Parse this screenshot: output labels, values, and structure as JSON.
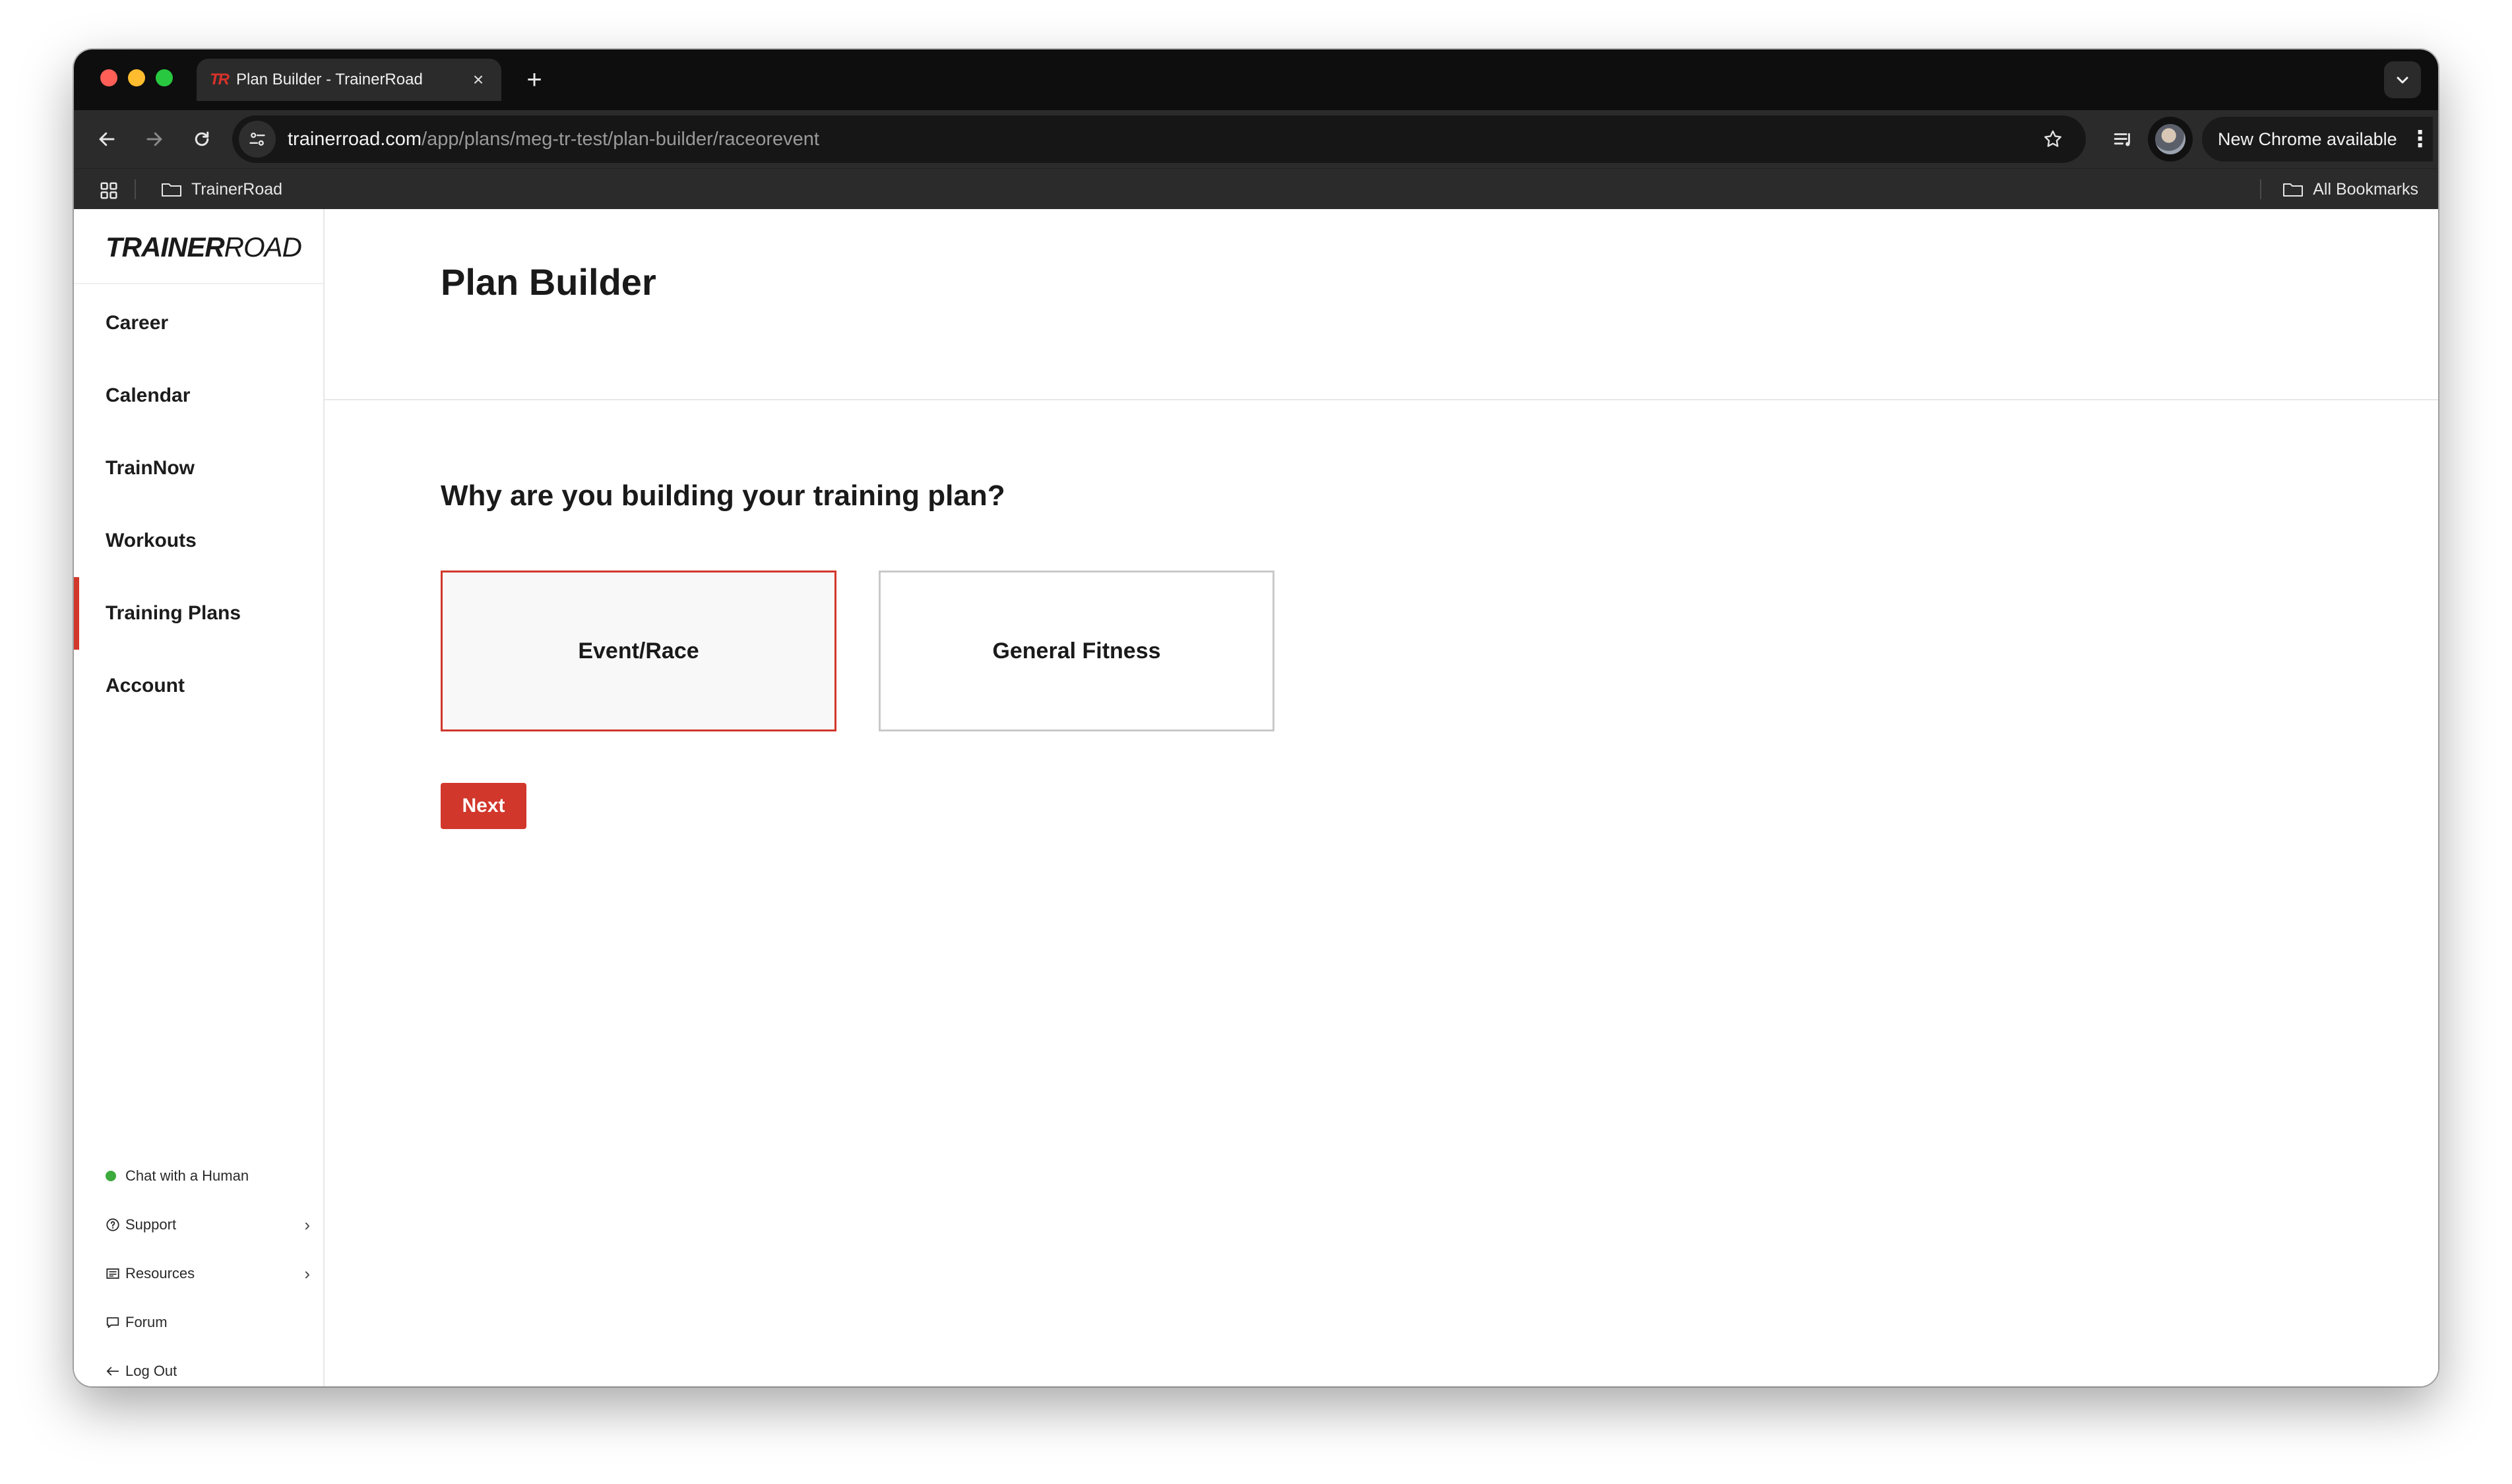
{
  "browser": {
    "tab_title": "Plan Builder - TrainerRoad",
    "tab_favicon": "TR",
    "url_host": "trainerroad.com",
    "url_path": "/app/plans/meg-tr-test/plan-builder/raceorevent",
    "update_label": "New Chrome available",
    "bookmarks": {
      "left_item": "TrainerRoad",
      "right_item": "All Bookmarks"
    }
  },
  "sidebar": {
    "logo_bold": "TRAINER",
    "logo_light": "ROAD",
    "nav": [
      {
        "label": "Career"
      },
      {
        "label": "Calendar"
      },
      {
        "label": "TrainNow"
      },
      {
        "label": "Workouts"
      },
      {
        "label": "Training Plans",
        "active": true
      },
      {
        "label": "Account"
      }
    ],
    "footer_links": [
      {
        "label": "Chat with a Human",
        "icon": "online-status-dot"
      },
      {
        "label": "Support",
        "icon": "help-circle-icon"
      },
      {
        "label": "Resources",
        "icon": "newspaper-icon"
      },
      {
        "label": "Forum",
        "icon": "chat-bubble-icon"
      },
      {
        "label": "Log Out",
        "icon": "arrow-left-icon"
      }
    ]
  },
  "main": {
    "title": "Plan Builder",
    "question": "Why are you building your training plan?",
    "choices": [
      {
        "label": "Event/Race",
        "selected": true
      },
      {
        "label": "General Fitness",
        "selected": false
      }
    ],
    "next_label": "Next"
  },
  "colors": {
    "accent": "#d2372c",
    "online": "#3caa3c"
  }
}
